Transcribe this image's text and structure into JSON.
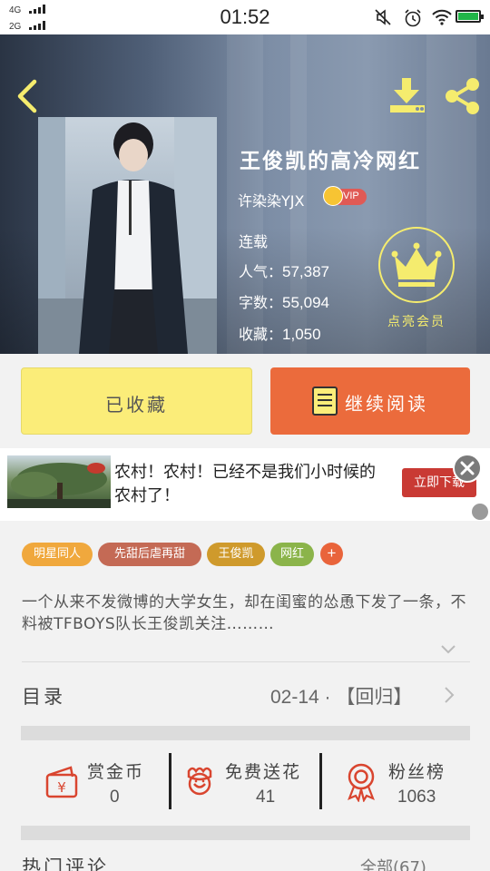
{
  "status_bar": {
    "signal_1": "4G",
    "signal_2": "2G",
    "time": "01:52"
  },
  "book": {
    "title": "王俊凯的高冷网红",
    "author": "许染染YJX",
    "vip_label": "VIP",
    "status": "连载",
    "popularity_label": "人气：",
    "popularity": "57,387",
    "words_label": "字数：",
    "words": "55,094",
    "favorites_label": "收藏：",
    "favorites": "1,050",
    "member_label": "点亮会员"
  },
  "actions": {
    "favorited": "已收藏",
    "continue_reading": "继续阅读"
  },
  "ad": {
    "text": "农村！农村！已经不是我们小时候的农村了！",
    "cta": "立即下载"
  },
  "tags": [
    "明星同人",
    "先甜后虐再甜",
    "王俊凯",
    "网红"
  ],
  "tag_plus": "+",
  "description": "一个从来不发微博的大学女生，却在闺蜜的怂恿下发了一条，不料被TFBOYS队长王俊凯关注………",
  "toc": {
    "label": "目录",
    "latest": "02-14 · 【回归】"
  },
  "stats": [
    {
      "label": "赏金币",
      "value": "0"
    },
    {
      "label": "免费送花",
      "value": "41"
    },
    {
      "label": "粉丝榜",
      "value": "1063"
    }
  ],
  "comments": {
    "label": "热门评论",
    "all": "全部(67)"
  },
  "colors": {
    "accent_yellow": "#fbed79",
    "accent_orange": "#eb6b3c",
    "member_yellow": "#f5ec6e",
    "icon_red": "#d9452f"
  },
  "icons": [
    "back-icon",
    "download-icon",
    "share-icon",
    "crown-icon",
    "book-icon",
    "close-icon",
    "red-envelope-icon",
    "flower-icon",
    "medal-icon",
    "chevron-right-icon",
    "chevron-down-icon"
  ]
}
